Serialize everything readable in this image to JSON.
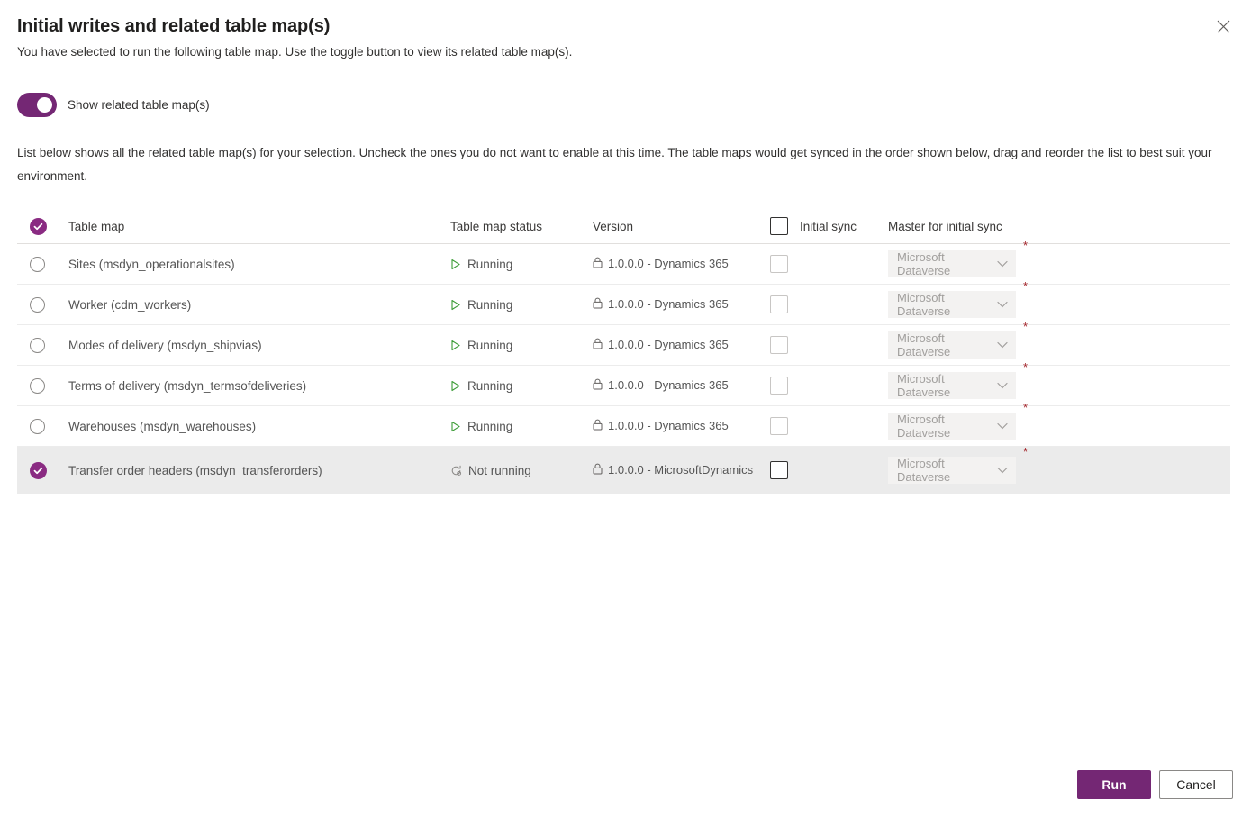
{
  "dialog": {
    "title": "Initial writes and related table map(s)",
    "subtitle": "You have selected to run the following table map. Use the toggle button to view its related table map(s).",
    "close_label": "Close",
    "note": "List below shows all the related table map(s) for your selection. Uncheck the ones you do not want to enable at this time. The table maps would get synced in the order shown below, drag and reorder the list to best suit your environment."
  },
  "toggle": {
    "label": "Show related table map(s)",
    "state": "on"
  },
  "table": {
    "headers": {
      "table_map": "Table map",
      "status": "Table map status",
      "version": "Version",
      "initial_sync": "Initial sync",
      "master": "Master for initial sync"
    },
    "rows": [
      {
        "name": "Sites (msdyn_operationalsites)",
        "status": "Running",
        "status_icon": "play-icon",
        "version": "1.0.0.0 - Dynamics 365",
        "initial_sync_checked": false,
        "master": "Microsoft Dataverse",
        "required": "*",
        "selected": false
      },
      {
        "name": "Worker (cdm_workers)",
        "status": "Running",
        "status_icon": "play-icon",
        "version": "1.0.0.0 - Dynamics 365",
        "initial_sync_checked": false,
        "master": "Microsoft Dataverse",
        "required": "*",
        "selected": false
      },
      {
        "name": "Modes of delivery (msdyn_shipvias)",
        "status": "Running",
        "status_icon": "play-icon",
        "version": "1.0.0.0 - Dynamics 365",
        "initial_sync_checked": false,
        "master": "Microsoft Dataverse",
        "required": "*",
        "selected": false
      },
      {
        "name": "Terms of delivery (msdyn_termsofdeliveries)",
        "status": "Running",
        "status_icon": "play-icon",
        "version": "1.0.0.0 - Dynamics 365",
        "initial_sync_checked": false,
        "master": "Microsoft Dataverse",
        "required": "*",
        "selected": false
      },
      {
        "name": "Warehouses (msdyn_warehouses)",
        "status": "Running",
        "status_icon": "play-icon",
        "version": "1.0.0.0 - Dynamics 365",
        "initial_sync_checked": false,
        "master": "Microsoft Dataverse",
        "required": "*",
        "selected": false
      },
      {
        "name": "Transfer order headers (msdyn_transferorders)",
        "status": "Not running",
        "status_icon": "refresh-off-icon",
        "version": "1.0.0.0 - MicrosoftDynamics",
        "initial_sync_checked": false,
        "master": "Microsoft Dataverse",
        "required": "*",
        "selected": true
      }
    ],
    "header_select_all_checked": true,
    "header_initial_sync_checked": false
  },
  "footer": {
    "run_label": "Run",
    "cancel_label": "Cancel"
  },
  "colors": {
    "accent_purple": "#742774",
    "select_purple": "#8a2b82",
    "running_green": "#3a9b35",
    "required_red": "#a4262c",
    "row_selected_bg": "#ebebeb"
  }
}
